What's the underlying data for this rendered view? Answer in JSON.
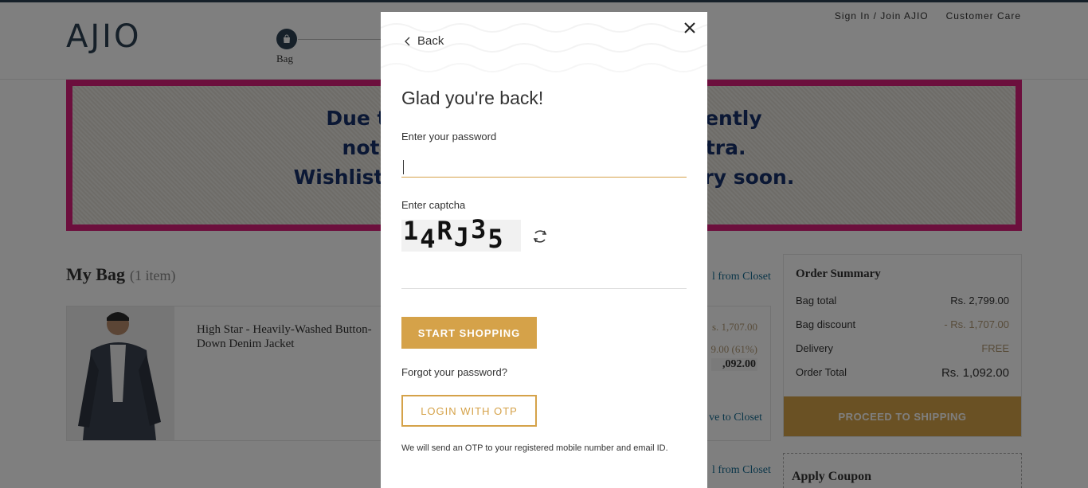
{
  "header": {
    "logo": "AJIO",
    "links": [
      "Sign In / Join AJIO",
      "Customer Care"
    ],
    "step_label": "Bag"
  },
  "banner": {
    "lines": [
      "Due to g                                    urrently",
      "not acc                                   ashtra.",
      "Wishlist all yo                            ck very soon."
    ]
  },
  "bag": {
    "title": "My Bag",
    "count": "(1 item)",
    "add_from_closet": "l from Closet",
    "item": {
      "name": "High Star - Heavily-Washed Button-Down Denim Jacket",
      "price_original": "s. 1,707.00",
      "price_strike": "9.00 (61%)",
      "price_final": ",092.00",
      "move_to_closet": "ve to Closet"
    }
  },
  "summary": {
    "title": "Order Summary",
    "rows": [
      {
        "label": "Bag total",
        "value": "Rs. 2,799.00"
      },
      {
        "label": "Bag discount",
        "value": "- Rs. 1,707.00"
      },
      {
        "label": "Delivery",
        "value": "FREE"
      },
      {
        "label": "Order Total",
        "value": "Rs. 1,092.00"
      }
    ],
    "proceed_label": "PROCEED TO SHIPPING",
    "coupon_title": "Apply Coupon"
  },
  "modal": {
    "back_label": "Back",
    "title": "Glad you're back!",
    "password_label": "Enter your password",
    "password_value": "",
    "captcha_label": "Enter captcha",
    "captcha_chars": [
      "1",
      "4",
      "R",
      "J",
      "3",
      "5"
    ],
    "captcha_value": "",
    "start_shopping_label": "START SHOPPING",
    "forgot_label": "Forgot your password?",
    "otp_label": "LOGIN WITH OTP",
    "otp_note": "We will send an OTP to your registered mobile number and email ID."
  },
  "icons": {
    "close": "close-icon",
    "back": "chevron-left-icon",
    "refresh": "refresh-icon",
    "bag": "bag-icon"
  },
  "colors": {
    "accent": "#d5a249",
    "brand": "#2c4152",
    "banner_border": "#d81e7a",
    "link": "#176d93"
  }
}
